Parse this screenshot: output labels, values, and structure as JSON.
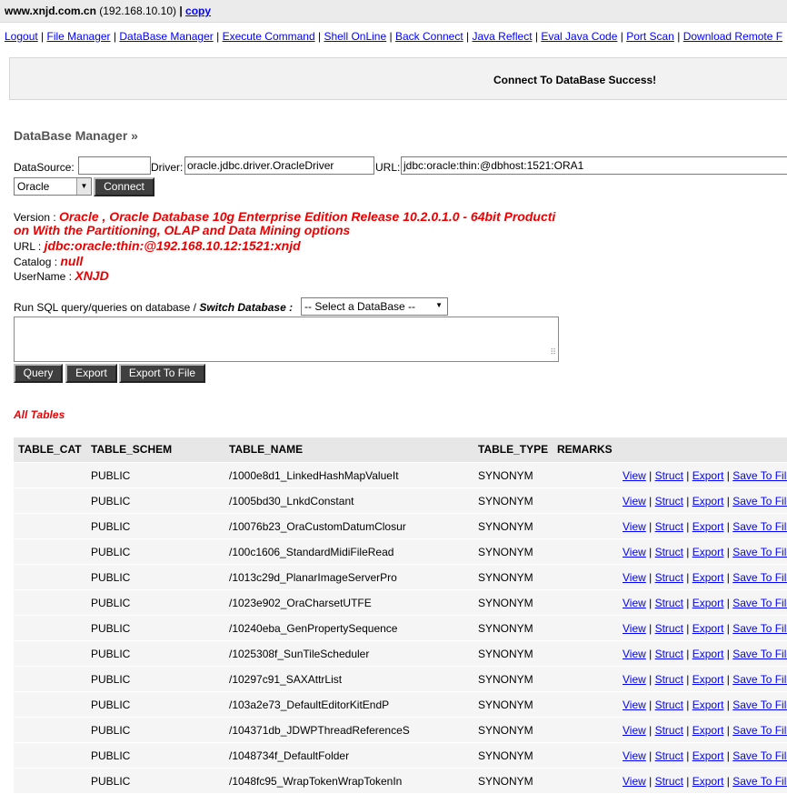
{
  "topbar": {
    "host": "www.xnjd.com.cn",
    "ip": "(192.168.10.10)",
    "sep": "|",
    "copy_label": "copy"
  },
  "nav": {
    "items": [
      "Logout",
      "File Manager",
      "DataBase Manager",
      "Execute Command",
      "Shell OnLine",
      "Back Connect",
      "Java Reflect",
      "Eval Java Code",
      "Port Scan",
      "Download Remote F"
    ],
    "separator": "|"
  },
  "message": "Connect To DataBase Success!",
  "heading": "DataBase Manager »",
  "form": {
    "datasource_label": "DataSource:",
    "datasource_value": "",
    "driver_label": "Driver:",
    "driver_value": "oracle.jdbc.driver.OracleDriver",
    "url_label": "URL:",
    "url_value": "jdbc:oracle:thin:@dbhost:1521:ORA1",
    "db_type": "Oracle",
    "connect_label": "Connect"
  },
  "dbinfo": {
    "version_label": "Version :",
    "version_line1": "Oracle , Oracle Database 10g Enterprise Edition Release 10.2.0.1.0 - 64bit Producti",
    "version_line2": "on With the Partitioning, OLAP and Data Mining options",
    "url_label": "URL :",
    "url_value": "jdbc:oracle:thin:@192.168.10.12:1521:xnjd",
    "catalog_label": "Catalog :",
    "catalog_value": "null",
    "username_label": "UserName :",
    "username_value": "XNJD"
  },
  "sql": {
    "run_label": "Run SQL query/queries on database /",
    "switch_label": "Switch Database :",
    "select_value": "-- Select a DataBase --",
    "query_value": "",
    "query_button": "Query",
    "export_button": "Export",
    "export_file_button": "Export To File"
  },
  "tables": {
    "title": "All Tables",
    "columns": [
      "TABLE_CAT",
      "TABLE_SCHEM",
      "TABLE_NAME",
      "TABLE_TYPE",
      "REMARKS"
    ],
    "actions": [
      "View",
      "Struct",
      "Export",
      "Save To File"
    ],
    "rows": [
      {
        "cat": "",
        "schem": "PUBLIC",
        "name": "/1000e8d1_LinkedHashMapValueIt",
        "type": "SYNONYM",
        "remarks": ""
      },
      {
        "cat": "",
        "schem": "PUBLIC",
        "name": "/1005bd30_LnkdConstant",
        "type": "SYNONYM",
        "remarks": ""
      },
      {
        "cat": "",
        "schem": "PUBLIC",
        "name": "/10076b23_OraCustomDatumClosur",
        "type": "SYNONYM",
        "remarks": ""
      },
      {
        "cat": "",
        "schem": "PUBLIC",
        "name": "/100c1606_StandardMidiFileRead",
        "type": "SYNONYM",
        "remarks": ""
      },
      {
        "cat": "",
        "schem": "PUBLIC",
        "name": "/1013c29d_PlanarImageServerPro",
        "type": "SYNONYM",
        "remarks": ""
      },
      {
        "cat": "",
        "schem": "PUBLIC",
        "name": "/1023e902_OraCharsetUTFE",
        "type": "SYNONYM",
        "remarks": ""
      },
      {
        "cat": "",
        "schem": "PUBLIC",
        "name": "/10240eba_GenPropertySequence",
        "type": "SYNONYM",
        "remarks": ""
      },
      {
        "cat": "",
        "schem": "PUBLIC",
        "name": "/1025308f_SunTileScheduler",
        "type": "SYNONYM",
        "remarks": ""
      },
      {
        "cat": "",
        "schem": "PUBLIC",
        "name": "/10297c91_SAXAttrList",
        "type": "SYNONYM",
        "remarks": ""
      },
      {
        "cat": "",
        "schem": "PUBLIC",
        "name": "/103a2e73_DefaultEditorKitEndP",
        "type": "SYNONYM",
        "remarks": ""
      },
      {
        "cat": "",
        "schem": "PUBLIC",
        "name": "/104371db_JDWPThreadReferenceS",
        "type": "SYNONYM",
        "remarks": ""
      },
      {
        "cat": "",
        "schem": "PUBLIC",
        "name": "/1048734f_DefaultFolder",
        "type": "SYNONYM",
        "remarks": ""
      },
      {
        "cat": "",
        "schem": "PUBLIC",
        "name": "/1048fc95_WrapTokenWrapTokenIn",
        "type": "SYNONYM",
        "remarks": ""
      }
    ]
  }
}
